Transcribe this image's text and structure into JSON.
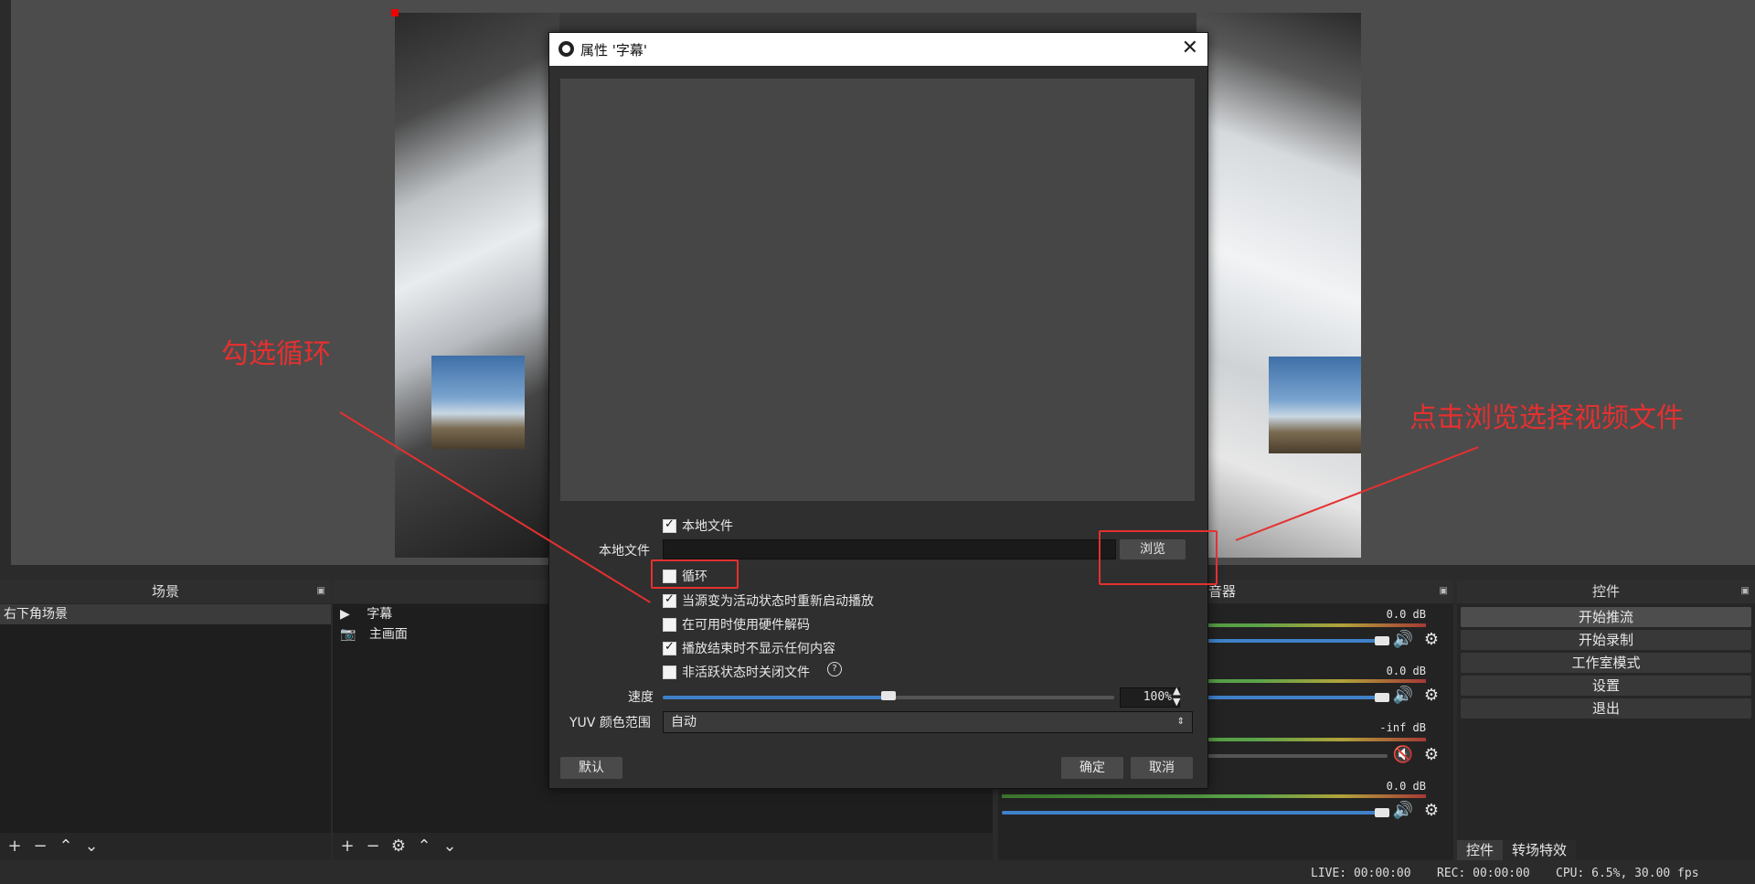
{
  "dialog": {
    "title": "属性 '字幕'",
    "close_icon": "close-icon",
    "local_file_label": "本地文件",
    "local_file_checkbox": "本地文件",
    "local_file_value": "",
    "browse_label": "浏览",
    "options": [
      {
        "label": "循环",
        "checked": false
      },
      {
        "label": "当源变为活动状态时重新启动播放",
        "checked": true
      },
      {
        "label": "在可用时使用硬件解码",
        "checked": false
      },
      {
        "label": "播放结束时不显示任何内容",
        "checked": true
      },
      {
        "label": "非活跃状态时关闭文件",
        "checked": false
      }
    ],
    "speed_label": "速度",
    "speed_value": "100%",
    "speed_fraction": 0.5,
    "yuv_label": "YUV 颜色范围",
    "yuv_value": "自动",
    "defaults_label": "默认",
    "ok_label": "确定",
    "cancel_label": "取消"
  },
  "annotations": {
    "left_text": "勾选循环",
    "right_text": "点击浏览选择视频文件",
    "color": "#e53030"
  },
  "scenes": {
    "title": "场景",
    "items": [
      "右下角场景"
    ]
  },
  "sources": {
    "items": [
      "字幕",
      "主画面"
    ]
  },
  "mixer": {
    "title_partial": "音器",
    "tracks": [
      {
        "db": "0.0 dB",
        "muted": false
      },
      {
        "db": "0.0 dB",
        "muted": false
      },
      {
        "db": "-inf dB",
        "muted": true
      },
      {
        "db": "0.0 dB",
        "muted": false
      }
    ]
  },
  "controls": {
    "title": "控件",
    "buttons": [
      "开始推流",
      "开始录制",
      "工作室模式",
      "设置",
      "退出"
    ],
    "tabs": [
      "控件",
      "转场特效"
    ]
  },
  "status": {
    "live": "LIVE: 00:00:00",
    "rec": "REC: 00:00:00",
    "cpu": "CPU: 6.5%, 30.00 fps"
  }
}
